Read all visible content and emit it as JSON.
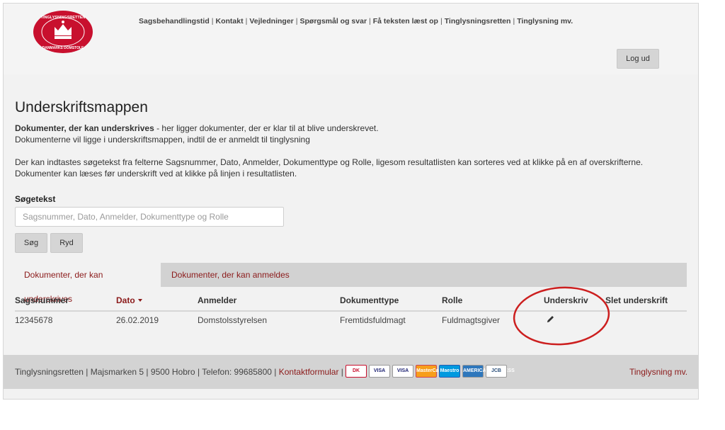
{
  "header": {
    "logo_top": "TINGLYSNINGSRETTEN",
    "logo_bottom": "DANMARKS DOMSTOLE",
    "nav": [
      "Sagsbehandlingstid",
      "Kontakt",
      "Vejledninger",
      "Spørgsmål og svar",
      "Få teksten læst op",
      "Tinglysningsretten",
      "Tinglysning mv."
    ],
    "logout_label": "Log ud"
  },
  "page": {
    "title": "Underskriftsmappen",
    "intro_bold": "Dokumenter, der kan underskrives",
    "intro_rest": " - her ligger dokumenter, der er klar til at blive underskrevet.",
    "intro_line2": "Dokumenterne vil ligge i underskriftsmappen, indtil de er anmeldt til tinglysning",
    "intro_line3": "Der kan indtastes søgetekst fra felterne Sagsnummer, Dato, Anmelder, Dokumenttype og Rolle, ligesom resultatlisten kan sorteres ved at klikke på en af overskrifterne.",
    "intro_line4": "Dokumenter kan læses før underskrift ved at klikke på linjen i resultatlisten."
  },
  "search": {
    "label": "Søgetekst",
    "placeholder": "Sagsnummer, Dato, Anmelder, Dokumenttype og Rolle",
    "value": "",
    "search_button": "Søg",
    "clear_button": "Ryd"
  },
  "tabs": [
    {
      "label": "Dokumenter, der kan underskrives",
      "active": true
    },
    {
      "label": "Dokumenter, der kan anmeldes",
      "active": false
    }
  ],
  "table": {
    "columns": [
      "Sagsnummer",
      "Dato",
      "Anmelder",
      "Dokumenttype",
      "Rolle",
      "Underskriv",
      "Slet underskrift"
    ],
    "sorted_column": "Dato",
    "rows": [
      {
        "sagsnummer": "12345678",
        "dato": "26.02.2019",
        "anmelder": "Domstolsstyrelsen",
        "dokumenttype": "Fremtidsfuldmagt",
        "rolle": "Fuldmagtsgiver",
        "underskriv_icon": "pencil-icon",
        "slet": ""
      }
    ]
  },
  "footer": {
    "org": "Tinglysningsretten",
    "address": "Majsmarken 5",
    "city": "9500 Hobro",
    "phone": "Telefon: 99685800",
    "contact_link": "Kontaktformular",
    "cards": [
      "DK",
      "VISA",
      "VISA",
      "MasterCard",
      "Maestro",
      "AMERICAN EXPRESS",
      "JCB"
    ],
    "right_link": "Tinglysning mv."
  },
  "colors": {
    "accent": "#8b1a1a",
    "logo_red": "#c8102e",
    "annotation": "#cc1f1f"
  }
}
